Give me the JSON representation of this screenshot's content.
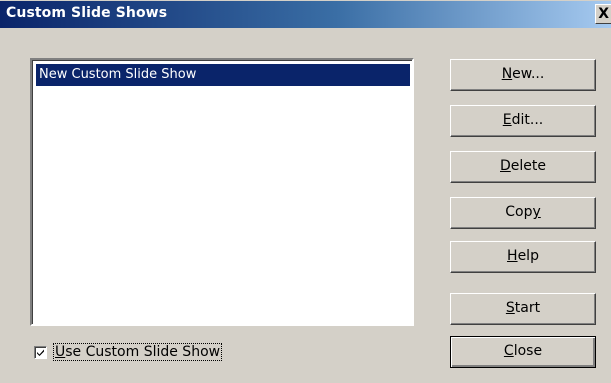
{
  "window": {
    "title": "Custom Slide Shows",
    "close_glyph": "X"
  },
  "list": {
    "items": [
      {
        "label": "New Custom Slide Show",
        "selected": true
      }
    ]
  },
  "buttons": [
    {
      "id": "new",
      "label_pre": "",
      "mnemonic": "N",
      "label_post": "ew..."
    },
    {
      "id": "edit",
      "label_pre": "",
      "mnemonic": "E",
      "label_post": "dit..."
    },
    {
      "id": "delete",
      "label_pre": "",
      "mnemonic": "D",
      "label_post": "elete"
    },
    {
      "id": "copy",
      "label_pre": "Cop",
      "mnemonic": "y",
      "label_post": ""
    },
    {
      "id": "help",
      "label_pre": "",
      "mnemonic": "H",
      "label_post": "elp"
    },
    {
      "id": "start",
      "label_pre": "",
      "mnemonic": "S",
      "label_post": "tart"
    },
    {
      "id": "close",
      "label_pre": "",
      "mnemonic": "C",
      "label_post": "lose"
    }
  ],
  "checkbox": {
    "checked": true,
    "label_pre": "",
    "mnemonic": "U",
    "label_post": "se Custom Slide Show"
  }
}
